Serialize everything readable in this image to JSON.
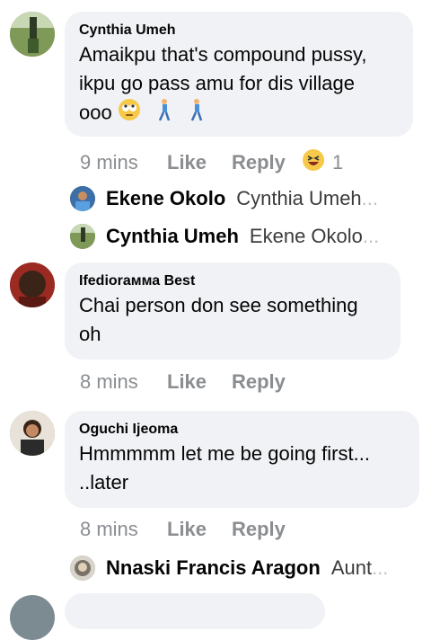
{
  "comments": [
    {
      "author": "Cynthia Umeh",
      "line1": "Amaikpu that's compound pussy,",
      "line2": "ikpu go pass amu for dis village",
      "line3": "ooo",
      "time": "9 mins",
      "like": "Like",
      "reply": "Reply",
      "reaction_count": "1",
      "replies": [
        {
          "name": "Ekene Okolo",
          "preview": "Cynthia Umeh",
          "ellipsis": "..."
        },
        {
          "name": "Cynthia Umeh",
          "preview": "Ekene Okolo",
          "ellipsis": "..."
        }
      ]
    },
    {
      "author": "Ifediorамма Best",
      "line1": "Chai person don see something",
      "line2": "oh",
      "time": "8 mins",
      "like": "Like",
      "reply": "Reply"
    },
    {
      "author": "Oguchi Ijeoma",
      "line1": "Hmmmmm let me be going first...",
      "line2": "..later",
      "time": "8 mins",
      "like": "Like",
      "reply": "Reply",
      "replies": [
        {
          "name": "Nnaski Francis Aragon",
          "preview": "Aunt",
          "ellipsis": "..."
        }
      ]
    }
  ],
  "colors": {
    "bubble": "#f0f2f5",
    "meta": "#8a8d91",
    "text": "#050505"
  }
}
